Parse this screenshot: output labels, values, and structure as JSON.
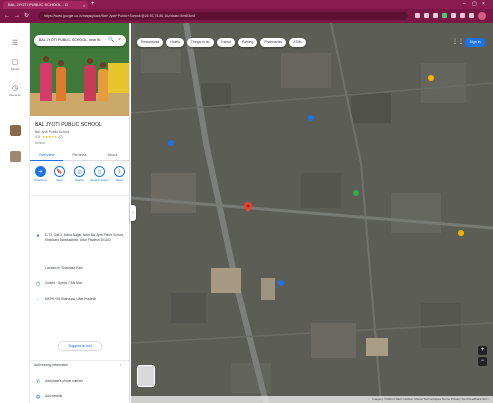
{
  "browser": {
    "tab_title": "BAL JYOTI PUBLIC SCHOOL - G",
    "url": "https://www.google.co.in/maps/place/Bal+Jyoti+Public+School/@26.93,75.80,16z/data=!4m6!3m5",
    "close_glyph": "×",
    "new_tab_glyph": "+",
    "nav": {
      "back": "←",
      "forward": "→",
      "reload": "↻"
    }
  },
  "rail": {
    "items": [
      {
        "icon": "☰",
        "label": ""
      },
      {
        "icon": "▢",
        "label": "Saved"
      },
      {
        "icon": "◷",
        "label": "Recents"
      }
    ]
  },
  "panel": {
    "search_value": "BAL JYOTI PUBLIC SCHOOL, near Bi",
    "search_icon": "🔍",
    "close_icon": "×",
    "place_name": "BAL JYOTI PUBLIC SCHOOL",
    "address_short": "Bal Jyoti Public School",
    "rating": "4.5",
    "stars": "★★★★★",
    "reviews": "(2)",
    "category": "School",
    "tabs": [
      "Overview",
      "Reviews",
      "About"
    ],
    "actions": [
      {
        "icon": "➜",
        "label": "Directions"
      },
      {
        "icon": "🔖",
        "label": "Save"
      },
      {
        "icon": "◎",
        "label": "Nearby"
      },
      {
        "icon": "▯",
        "label": "Send to phone"
      },
      {
        "icon": "⇪",
        "label": "Share"
      }
    ],
    "address_full": "C-73, Gali 3, Indira Nagar, Near Bal Jyoti Public School, Shahdara Dwarkadhish, Uttar Pradesh 201102",
    "located_in": "Located in: Shahdara Park",
    "hours": "Closed · Opens 7 AM Mon",
    "plus_code": "MXPH+V8 Shahdara, Uttar Pradesh",
    "suggest_edit": "Suggest an edit",
    "add_info": "Add missing information",
    "add_phone": "Add place's phone number",
    "add_website": "Add website"
  },
  "map": {
    "chips": [
      "Restaurants",
      "Hotels",
      "Things to do",
      "Transit",
      "Parking",
      "Pharmacies",
      "ATMs"
    ],
    "sign_in": "Sign in",
    "apps_icon": "⋮⋮⋮",
    "zoom_in": "+",
    "zoom_out": "−",
    "attribution": "Imagery ©2023 CNES / Airbus, Maxar Technologies  Terms  Privacy  Send feedback  20 m"
  },
  "colors": {
    "tabstrip": "#8a1b4f",
    "toolbar": "#7a1646",
    "accent": "#1a73e8",
    "pin": "#ea4335",
    "star": "#f4b400"
  }
}
